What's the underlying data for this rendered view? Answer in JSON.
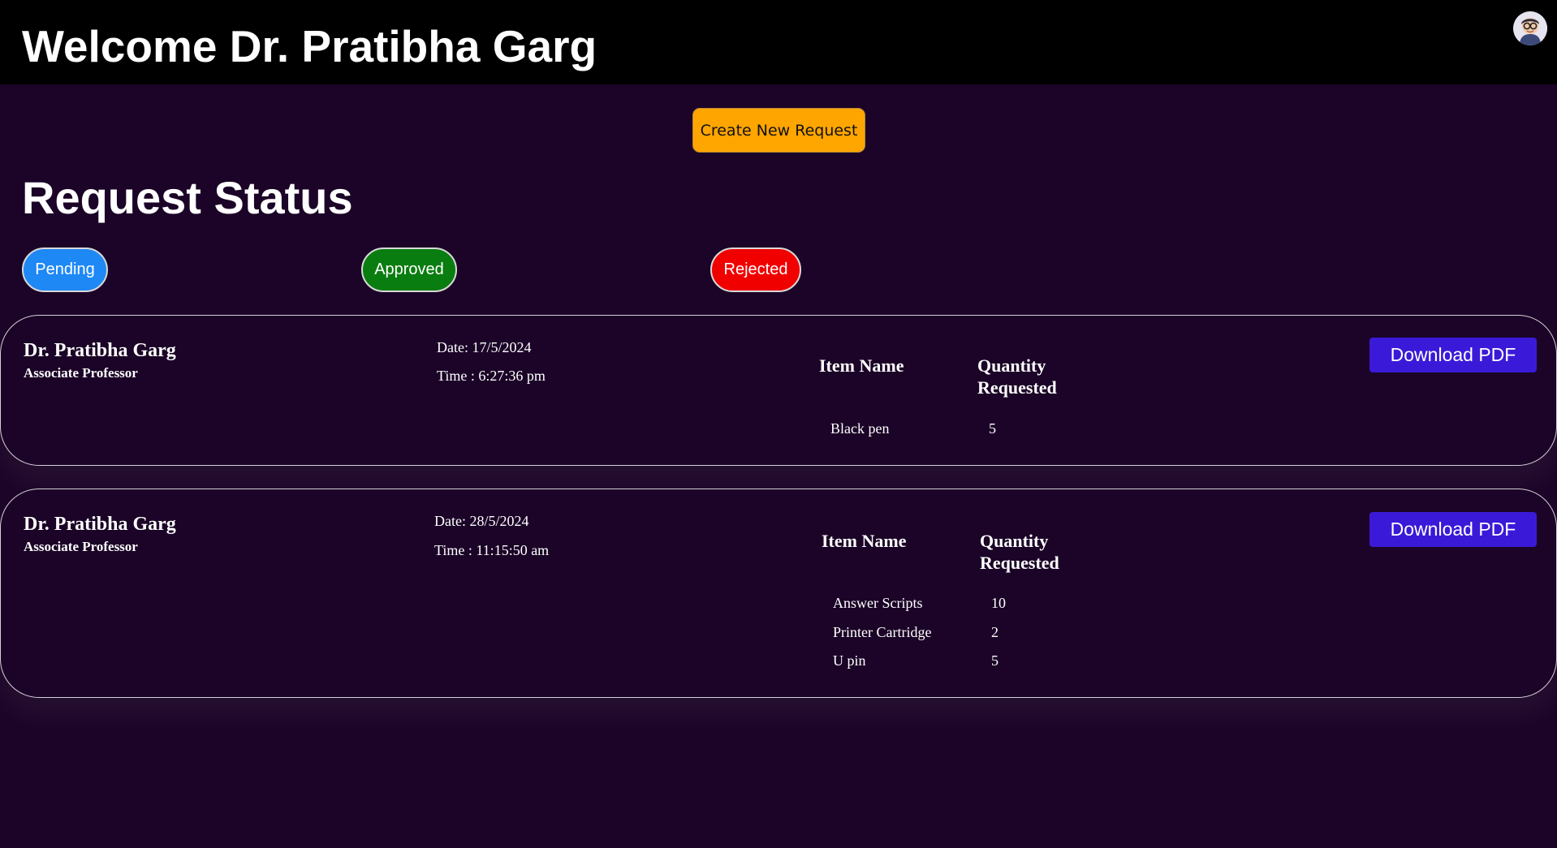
{
  "header": {
    "title": "Welcome Dr. Pratibha Garg"
  },
  "actions": {
    "create_label": "Create New Request"
  },
  "status_section": {
    "title": "Request Status",
    "filters": [
      {
        "label": "Pending",
        "color": "#1e88f5"
      },
      {
        "label": "Approved",
        "color": "#0a7d10"
      },
      {
        "label": "Rejected",
        "color": "#f10000"
      }
    ]
  },
  "requests": [
    {
      "name": "Dr. Pratibha Garg",
      "role": "Associate Professor",
      "date": "Date: 17/5/2024",
      "time": "Time : 6:27:36 pm",
      "col_item": "Item Name",
      "col_qty": "Quantity Requested",
      "items": [
        {
          "name": "Black pen",
          "qty": "5"
        }
      ],
      "download_label": "Download PDF"
    },
    {
      "name": "Dr. Pratibha Garg",
      "role": "Associate Professor",
      "date": "Date: 28/5/2024",
      "time": "Time : 11:15:50 am",
      "col_item": "Item Name",
      "col_qty": "Quantity Requested",
      "items": [
        {
          "name": "Answer Scripts",
          "qty": "10"
        },
        {
          "name": "Printer Cartridge",
          "qty": "2"
        },
        {
          "name": "U pin",
          "qty": "5"
        }
      ],
      "download_label": "Download PDF"
    }
  ],
  "icons": {
    "avatar": "user-avatar-icon"
  },
  "colors": {
    "background": "#1b0427",
    "header": "#000000",
    "create_button": "#ffa500",
    "download_button": "#3a1ad8"
  }
}
